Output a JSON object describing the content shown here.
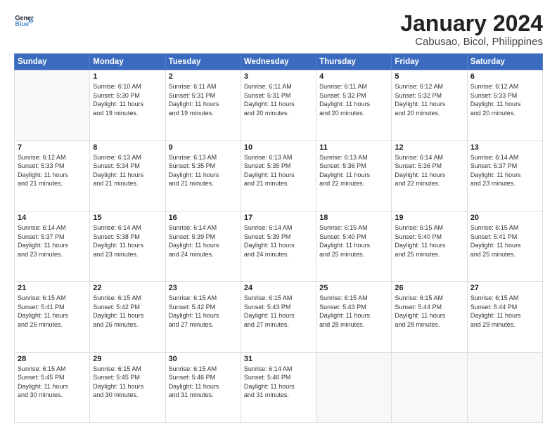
{
  "logo": {
    "line1": "General",
    "line2": "Blue",
    "arrow_color": "#4a90d9"
  },
  "title": "January 2024",
  "subtitle": "Cabusao, Bicol, Philippines",
  "header_days": [
    "Sunday",
    "Monday",
    "Tuesday",
    "Wednesday",
    "Thursday",
    "Friday",
    "Saturday"
  ],
  "weeks": [
    [
      {
        "day": "",
        "empty": true,
        "lines": []
      },
      {
        "day": "1",
        "lines": [
          "Sunrise: 6:10 AM",
          "Sunset: 5:30 PM",
          "Daylight: 11 hours",
          "and 19 minutes."
        ]
      },
      {
        "day": "2",
        "lines": [
          "Sunrise: 6:11 AM",
          "Sunset: 5:31 PM",
          "Daylight: 11 hours",
          "and 19 minutes."
        ]
      },
      {
        "day": "3",
        "lines": [
          "Sunrise: 6:11 AM",
          "Sunset: 5:31 PM",
          "Daylight: 11 hours",
          "and 20 minutes."
        ]
      },
      {
        "day": "4",
        "lines": [
          "Sunrise: 6:11 AM",
          "Sunset: 5:32 PM",
          "Daylight: 11 hours",
          "and 20 minutes."
        ]
      },
      {
        "day": "5",
        "lines": [
          "Sunrise: 6:12 AM",
          "Sunset: 5:32 PM",
          "Daylight: 11 hours",
          "and 20 minutes."
        ]
      },
      {
        "day": "6",
        "lines": [
          "Sunrise: 6:12 AM",
          "Sunset: 5:33 PM",
          "Daylight: 11 hours",
          "and 20 minutes."
        ]
      }
    ],
    [
      {
        "day": "7",
        "lines": [
          "Sunrise: 6:12 AM",
          "Sunset: 5:33 PM",
          "Daylight: 11 hours",
          "and 21 minutes."
        ]
      },
      {
        "day": "8",
        "lines": [
          "Sunrise: 6:13 AM",
          "Sunset: 5:34 PM",
          "Daylight: 11 hours",
          "and 21 minutes."
        ]
      },
      {
        "day": "9",
        "lines": [
          "Sunrise: 6:13 AM",
          "Sunset: 5:35 PM",
          "Daylight: 11 hours",
          "and 21 minutes."
        ]
      },
      {
        "day": "10",
        "lines": [
          "Sunrise: 6:13 AM",
          "Sunset: 5:35 PM",
          "Daylight: 11 hours",
          "and 21 minutes."
        ]
      },
      {
        "day": "11",
        "lines": [
          "Sunrise: 6:13 AM",
          "Sunset: 5:36 PM",
          "Daylight: 11 hours",
          "and 22 minutes."
        ]
      },
      {
        "day": "12",
        "lines": [
          "Sunrise: 6:14 AM",
          "Sunset: 5:36 PM",
          "Daylight: 11 hours",
          "and 22 minutes."
        ]
      },
      {
        "day": "13",
        "lines": [
          "Sunrise: 6:14 AM",
          "Sunset: 5:37 PM",
          "Daylight: 11 hours",
          "and 23 minutes."
        ]
      }
    ],
    [
      {
        "day": "14",
        "lines": [
          "Sunrise: 6:14 AM",
          "Sunset: 5:37 PM",
          "Daylight: 11 hours",
          "and 23 minutes."
        ]
      },
      {
        "day": "15",
        "lines": [
          "Sunrise: 6:14 AM",
          "Sunset: 5:38 PM",
          "Daylight: 11 hours",
          "and 23 minutes."
        ]
      },
      {
        "day": "16",
        "lines": [
          "Sunrise: 6:14 AM",
          "Sunset: 5:39 PM",
          "Daylight: 11 hours",
          "and 24 minutes."
        ]
      },
      {
        "day": "17",
        "lines": [
          "Sunrise: 6:14 AM",
          "Sunset: 5:39 PM",
          "Daylight: 11 hours",
          "and 24 minutes."
        ]
      },
      {
        "day": "18",
        "lines": [
          "Sunrise: 6:15 AM",
          "Sunset: 5:40 PM",
          "Daylight: 11 hours",
          "and 25 minutes."
        ]
      },
      {
        "day": "19",
        "lines": [
          "Sunrise: 6:15 AM",
          "Sunset: 5:40 PM",
          "Daylight: 11 hours",
          "and 25 minutes."
        ]
      },
      {
        "day": "20",
        "lines": [
          "Sunrise: 6:15 AM",
          "Sunset: 5:41 PM",
          "Daylight: 11 hours",
          "and 25 minutes."
        ]
      }
    ],
    [
      {
        "day": "21",
        "lines": [
          "Sunrise: 6:15 AM",
          "Sunset: 5:41 PM",
          "Daylight: 11 hours",
          "and 26 minutes."
        ]
      },
      {
        "day": "22",
        "lines": [
          "Sunrise: 6:15 AM",
          "Sunset: 5:42 PM",
          "Daylight: 11 hours",
          "and 26 minutes."
        ]
      },
      {
        "day": "23",
        "lines": [
          "Sunrise: 6:15 AM",
          "Sunset: 5:42 PM",
          "Daylight: 11 hours",
          "and 27 minutes."
        ]
      },
      {
        "day": "24",
        "lines": [
          "Sunrise: 6:15 AM",
          "Sunset: 5:43 PM",
          "Daylight: 11 hours",
          "and 27 minutes."
        ]
      },
      {
        "day": "25",
        "lines": [
          "Sunrise: 6:15 AM",
          "Sunset: 5:43 PM",
          "Daylight: 11 hours",
          "and 28 minutes."
        ]
      },
      {
        "day": "26",
        "lines": [
          "Sunrise: 6:15 AM",
          "Sunset: 5:44 PM",
          "Daylight: 11 hours",
          "and 28 minutes."
        ]
      },
      {
        "day": "27",
        "lines": [
          "Sunrise: 6:15 AM",
          "Sunset: 5:44 PM",
          "Daylight: 11 hours",
          "and 29 minutes."
        ]
      }
    ],
    [
      {
        "day": "28",
        "lines": [
          "Sunrise: 6:15 AM",
          "Sunset: 5:45 PM",
          "Daylight: 11 hours",
          "and 30 minutes."
        ]
      },
      {
        "day": "29",
        "lines": [
          "Sunrise: 6:15 AM",
          "Sunset: 5:45 PM",
          "Daylight: 11 hours",
          "and 30 minutes."
        ]
      },
      {
        "day": "30",
        "lines": [
          "Sunrise: 6:15 AM",
          "Sunset: 5:46 PM",
          "Daylight: 11 hours",
          "and 31 minutes."
        ]
      },
      {
        "day": "31",
        "lines": [
          "Sunrise: 6:14 AM",
          "Sunset: 5:46 PM",
          "Daylight: 11 hours",
          "and 31 minutes."
        ]
      },
      {
        "day": "",
        "empty": true,
        "lines": []
      },
      {
        "day": "",
        "empty": true,
        "lines": []
      },
      {
        "day": "",
        "empty": true,
        "lines": []
      }
    ]
  ]
}
